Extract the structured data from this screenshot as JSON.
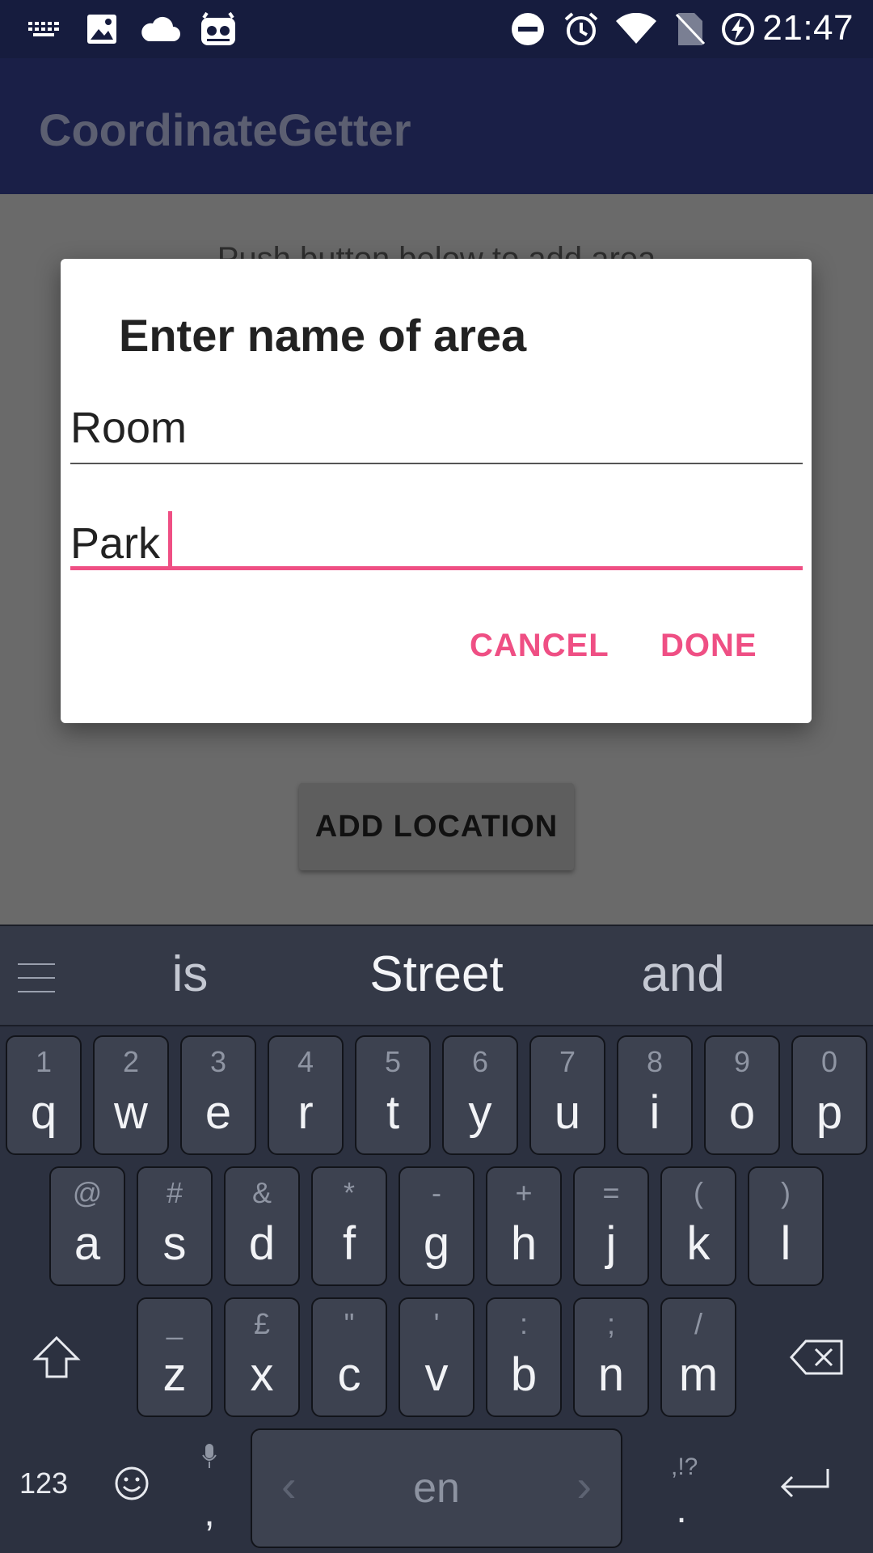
{
  "status_bar": {
    "time": "21:47",
    "icons": [
      "keyboard-icon",
      "image-icon",
      "cloud-icon",
      "cyanogen-icon",
      "do-not-disturb-icon",
      "alarm-icon",
      "wifi-icon",
      "no-sim-icon",
      "battery-charging-icon"
    ]
  },
  "app_bar": {
    "title": "CoordinateGetter"
  },
  "content": {
    "hint": "Push button below to add area",
    "add_location_label": "ADD LOCATION"
  },
  "dialog": {
    "title": "Enter name of area",
    "field1_value": "Room",
    "field2_value": "Park",
    "cancel_label": "CANCEL",
    "done_label": "DONE",
    "accent_color": "#ef4f84"
  },
  "keyboard": {
    "suggestions": [
      "is",
      "Street",
      "and"
    ],
    "row1": [
      {
        "hint": "1",
        "label": "q"
      },
      {
        "hint": "2",
        "label": "w"
      },
      {
        "hint": "3",
        "label": "e"
      },
      {
        "hint": "4",
        "label": "r"
      },
      {
        "hint": "5",
        "label": "t"
      },
      {
        "hint": "6",
        "label": "y"
      },
      {
        "hint": "7",
        "label": "u"
      },
      {
        "hint": "8",
        "label": "i"
      },
      {
        "hint": "9",
        "label": "o"
      },
      {
        "hint": "0",
        "label": "p"
      }
    ],
    "row2": [
      {
        "hint": "@",
        "label": "a"
      },
      {
        "hint": "#",
        "label": "s"
      },
      {
        "hint": "&",
        "label": "d"
      },
      {
        "hint": "*",
        "label": "f"
      },
      {
        "hint": "-",
        "label": "g"
      },
      {
        "hint": "+",
        "label": "h"
      },
      {
        "hint": "=",
        "label": "j"
      },
      {
        "hint": "(",
        "label": "k"
      },
      {
        "hint": ")",
        "label": "l"
      }
    ],
    "row3": [
      {
        "hint": "_",
        "label": "z"
      },
      {
        "hint": "£",
        "label": "x"
      },
      {
        "hint": "\"",
        "label": "c"
      },
      {
        "hint": "'",
        "label": "v"
      },
      {
        "hint": ":",
        "label": "b"
      },
      {
        "hint": ";",
        "label": "n"
      },
      {
        "hint": "/",
        "label": "m"
      }
    ],
    "numbers_label": "123",
    "comma_label": ",",
    "space_label": "en",
    "period_label": ".",
    "period_hint": ",!?"
  }
}
